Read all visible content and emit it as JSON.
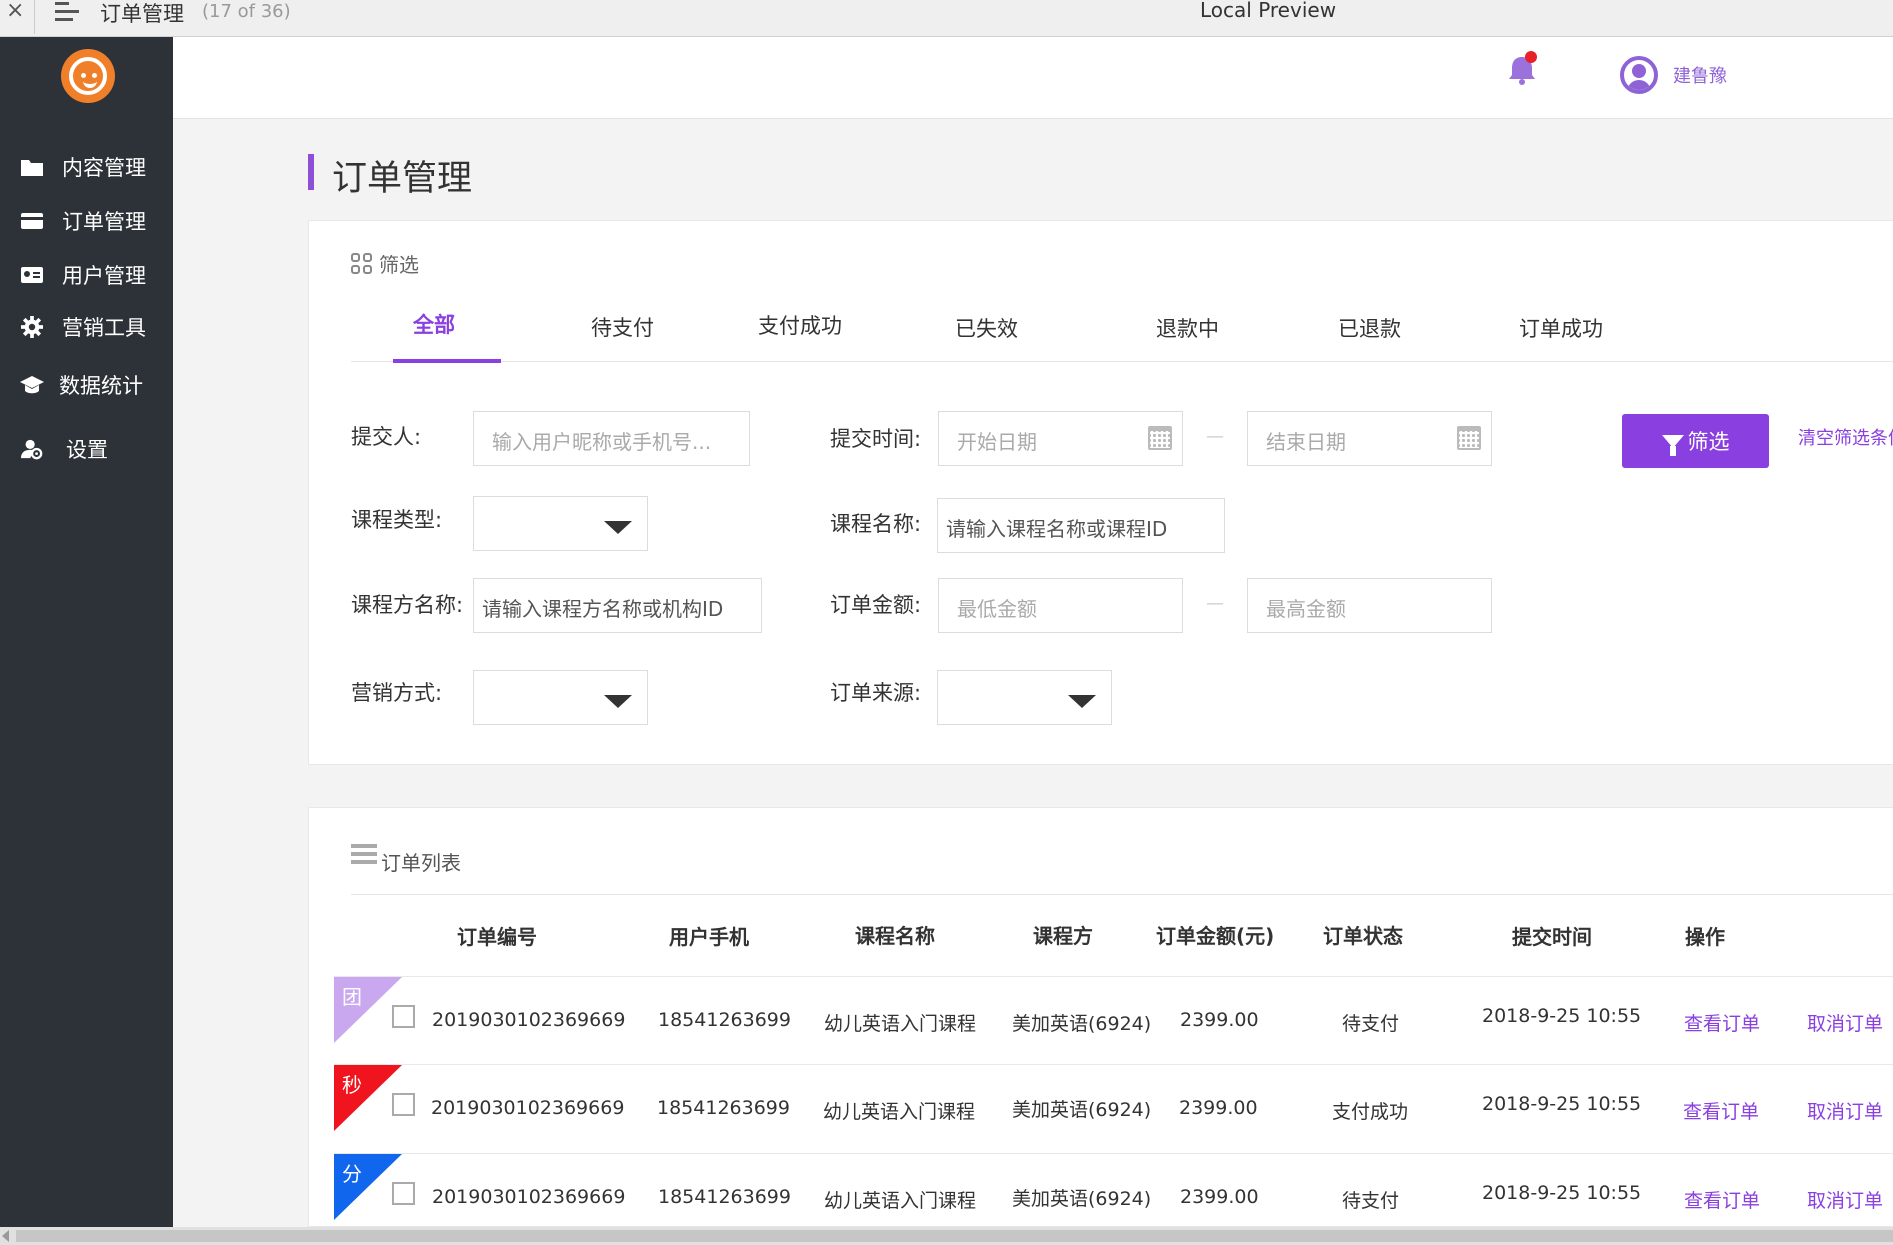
{
  "window": {
    "close_glyph": "×",
    "doc_title": "订单管理",
    "doc_count": "(17 of 36)",
    "app_title": "Local Preview"
  },
  "sidebar": {
    "items": [
      {
        "label": "内容管理",
        "icon": "folder-icon"
      },
      {
        "label": "订单管理",
        "icon": "card-icon"
      },
      {
        "label": "用户管理",
        "icon": "id-card-icon"
      },
      {
        "label": "营销工具",
        "icon": "gear-icon"
      },
      {
        "label": "数据统计",
        "icon": "graduation-cap-icon"
      },
      {
        "label": "设置",
        "icon": "user-settings-icon"
      }
    ]
  },
  "header": {
    "username": "建鲁豫",
    "notification_color": "#e8202a",
    "accent_color": "#8a3fe0"
  },
  "page": {
    "title": "订单管理"
  },
  "filter": {
    "heading": "筛选",
    "tabs": [
      "全部",
      "待支付",
      "支付成功",
      "已失效",
      "退款中",
      "已退款",
      "订单成功"
    ],
    "active_tab": "全部",
    "submitter_label": "提交人:",
    "submitter_placeholder": "输入用户昵称或手机号...",
    "submit_time_label": "提交时间:",
    "start_date_placeholder": "开始日期",
    "end_date_placeholder": "结束日期",
    "range_dash": "—",
    "course_type_label": "课程类型:",
    "course_name_label": "课程名称:",
    "course_name_value": "请输入课程名称或课程ID",
    "provider_label": "课程方名称:",
    "provider_value": "请输入课程方名称或机构ID",
    "amount_label": "订单金额:",
    "min_amount_placeholder": "最低金额",
    "max_amount_placeholder": "最高金额",
    "marketing_label": "营销方式:",
    "source_label": "订单来源:",
    "filter_button": "筛选",
    "clear_link": "清空筛选条件"
  },
  "orders": {
    "heading": "订单列表",
    "columns": [
      "订单编号",
      "用户手机",
      "课程名称",
      "课程方",
      "订单金额(元)",
      "订单状态",
      "提交时间",
      "操作"
    ],
    "rows": [
      {
        "tag": "团",
        "tag_color": "#c9a8f0",
        "order_no": "2019030102369669",
        "phone": "18541263699",
        "course": "幼儿英语入门课程",
        "provider": "美加英语(6924)",
        "amount": "2399.00",
        "status": "待支付",
        "time": "2018-9-25 10:55",
        "view": "查看订单",
        "cancel": "取消订单"
      },
      {
        "tag": "秒",
        "tag_color": "#f0141e",
        "order_no": "2019030102369669",
        "phone": "18541263699",
        "course": "幼儿英语入门课程",
        "provider": "美加英语(6924)",
        "amount": "2399.00",
        "status": "支付成功",
        "time": "2018-9-25 10:55",
        "view": "查看订单",
        "cancel": "取消订单"
      },
      {
        "tag": "分",
        "tag_color": "#1166ee",
        "order_no": "2019030102369669",
        "phone": "18541263699",
        "course": "幼儿英语入门课程",
        "provider": "美加英语(6924)",
        "amount": "2399.00",
        "status": "待支付",
        "time": "2018-9-25 10:55",
        "view": "查看订单",
        "cancel": "取消订单"
      }
    ]
  }
}
